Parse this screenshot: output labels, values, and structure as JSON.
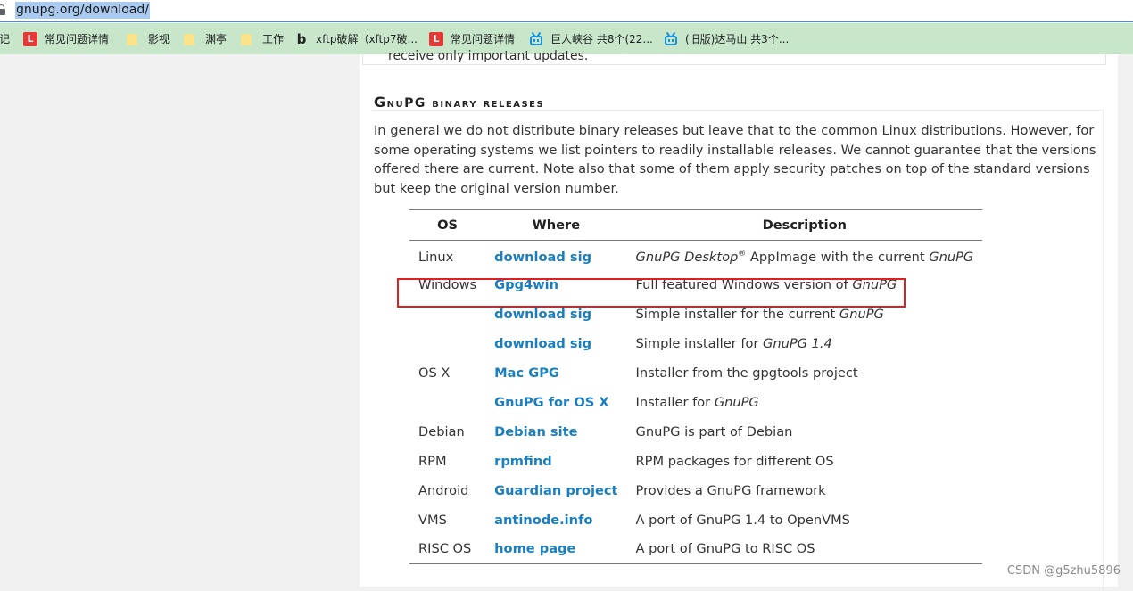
{
  "address_bar": {
    "url": "gnupg.org/download/"
  },
  "bookmarks": [
    {
      "label": "记",
      "icon": "none"
    },
    {
      "label": "常见问题详情",
      "icon": "l-logo-icon"
    },
    {
      "label": "影视",
      "icon": "folder-icon"
    },
    {
      "label": "渊亭",
      "icon": "folder-icon"
    },
    {
      "label": "工作",
      "icon": "folder-icon"
    },
    {
      "label": "xftp破解（xftp7破...",
      "icon": "b-logo-icon"
    },
    {
      "label": "常见问题详情",
      "icon": "l-logo-icon"
    },
    {
      "label": "巨人峡谷 共8个(22...",
      "icon": "bilibili-tv-icon"
    },
    {
      "label": "(旧版)达马山 共3个...",
      "icon": "bilibili-tv-icon"
    }
  ],
  "page": {
    "top_note": "receive only important updates.",
    "section_title_first": "G",
    "section_title_rest": "nuPG binary releases",
    "intro": "In general we do not distribute binary releases but leave that to the common Linux distributions. However, for some operating systems we list pointers to readily installable releases. We cannot guarantee that the versions offered there are current. Note also that some of them apply security patches on top of the standard versions but keep the original version number.",
    "table": {
      "headers": {
        "os": "OS",
        "where": "Where",
        "description": "Description"
      },
      "rows": [
        {
          "os": "Linux",
          "where": "download sig",
          "desc_parts": [
            {
              "t": "GnuPG Desktop",
              "i": true
            },
            {
              "t": "®",
              "sup": true
            },
            {
              "t": " AppImage with the current "
            },
            {
              "t": "GnuPG",
              "i": true
            }
          ]
        },
        {
          "os": "Windows",
          "where": "Gpg4win",
          "desc_parts": [
            {
              "t": "Full featured Windows version of "
            },
            {
              "t": "GnuPG",
              "i": true
            }
          ]
        },
        {
          "os": "",
          "where": "download sig",
          "desc_parts": [
            {
              "t": "Simple installer for the current "
            },
            {
              "t": "GnuPG",
              "i": true
            }
          ]
        },
        {
          "os": "",
          "where": "download sig",
          "desc_parts": [
            {
              "t": "Simple installer for "
            },
            {
              "t": "GnuPG 1.4",
              "i": true
            }
          ]
        },
        {
          "os": "OS X",
          "where": "Mac GPG",
          "desc_parts": [
            {
              "t": "Installer from the gpgtools project"
            }
          ]
        },
        {
          "os": "",
          "where": "GnuPG for OS X",
          "desc_parts": [
            {
              "t": "Installer for "
            },
            {
              "t": "GnuPG",
              "i": true
            }
          ]
        },
        {
          "os": "Debian",
          "where": "Debian site",
          "desc_parts": [
            {
              "t": "GnuPG is part of Debian"
            }
          ]
        },
        {
          "os": "RPM",
          "where": "rpmfind",
          "desc_parts": [
            {
              "t": "RPM packages for different OS"
            }
          ]
        },
        {
          "os": "Android",
          "where": "Guardian project",
          "desc_parts": [
            {
              "t": "Provides a GnuPG framework"
            }
          ]
        },
        {
          "os": "VMS",
          "where": "antinode.info",
          "desc_parts": [
            {
              "t": "A port of GnuPG 1.4 to OpenVMS"
            }
          ]
        },
        {
          "os": "RISC OS",
          "where": "home page",
          "desc_parts": [
            {
              "t": "A port of GnuPG to RISC OS"
            }
          ]
        }
      ]
    }
  },
  "watermark": "CSDN @g5zhu5896",
  "colors": {
    "link": "#1a7fc1",
    "highlight_box": "#e02020",
    "bookmark_bar": "#c8e6c9"
  }
}
